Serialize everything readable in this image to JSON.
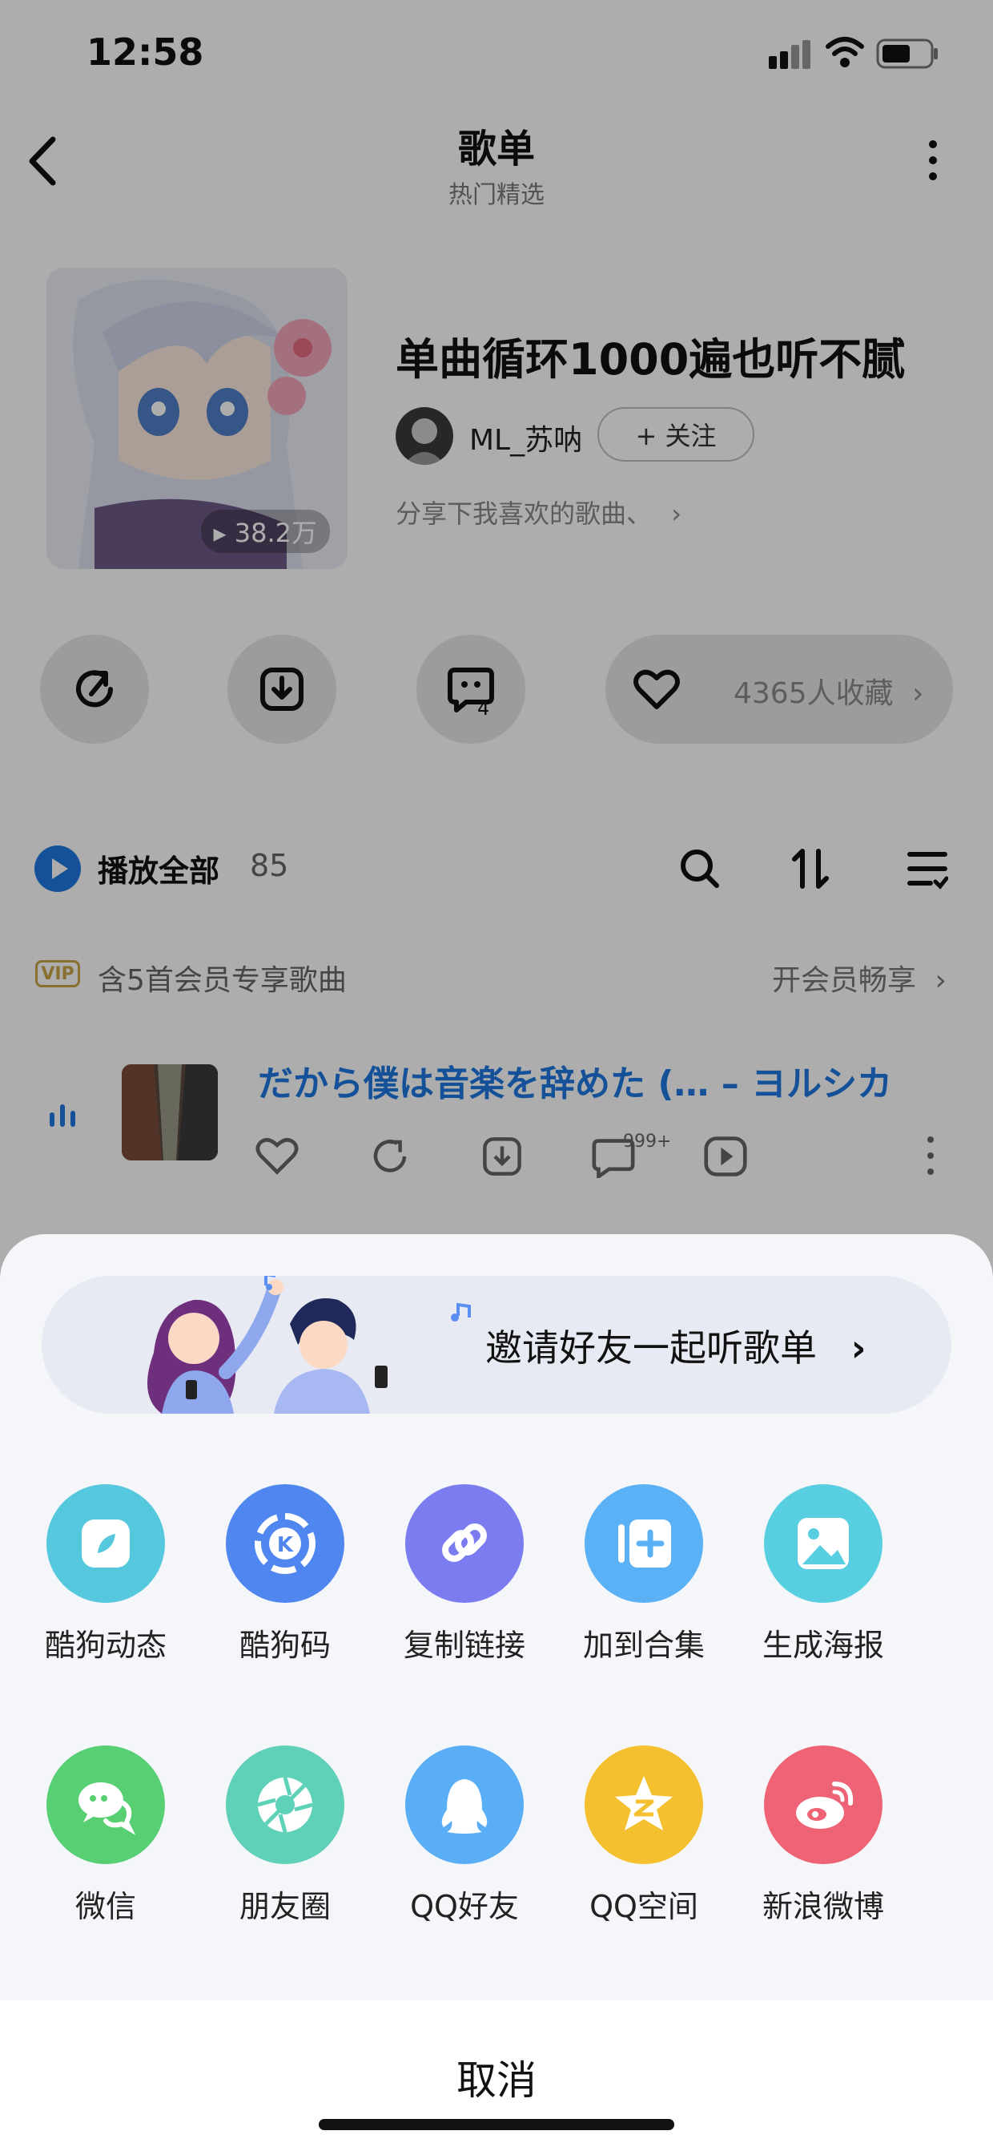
{
  "status_bar": {
    "time": "12:58"
  },
  "nav": {
    "title": "歌单",
    "subtitle": "热门精选"
  },
  "playlist": {
    "play_count": "38.2万",
    "title": "单曲循环1000遍也听不腻",
    "creator": "ML_苏呐",
    "follow_label": "+ 关注",
    "description": "分享下我喜欢的歌曲、",
    "comment_count": "4",
    "favorites": "4365人收藏"
  },
  "list": {
    "play_all_label": "播放全部",
    "count": "85",
    "vip_badge": "VIP",
    "vip_text": "含5首会员专享歌曲",
    "vip_link": "开会员畅享",
    "song_title": "だから僕は音楽を辞めた (… – ヨルシカ",
    "comment_badge": "999+"
  },
  "share_sheet": {
    "invite_text": "邀请好友一起听歌单",
    "row1": [
      {
        "label": "酷狗动态",
        "icon": "kugou-moments-icon",
        "color": "#56c8dd"
      },
      {
        "label": "酷狗码",
        "icon": "kugou-code-icon",
        "color": "#4f86f0"
      },
      {
        "label": "复制链接",
        "icon": "link-icon",
        "color": "#7b7cf0"
      },
      {
        "label": "加到合集",
        "icon": "add-collection-icon",
        "color": "#5ab1f5"
      },
      {
        "label": "生成海报",
        "icon": "poster-icon",
        "color": "#57cfe0"
      }
    ],
    "row2": [
      {
        "label": "微信",
        "icon": "wechat-icon",
        "color": "#57cf72"
      },
      {
        "label": "朋友圈",
        "icon": "moments-icon",
        "color": "#5fd1b8"
      },
      {
        "label": "QQ好友",
        "icon": "qq-icon",
        "color": "#5aaef5"
      },
      {
        "label": "QQ空间",
        "icon": "qzone-icon",
        "color": "#f5c030"
      },
      {
        "label": "新浪微博",
        "icon": "weibo-icon",
        "color": "#ef6376"
      }
    ],
    "cancel_label": "取消"
  }
}
